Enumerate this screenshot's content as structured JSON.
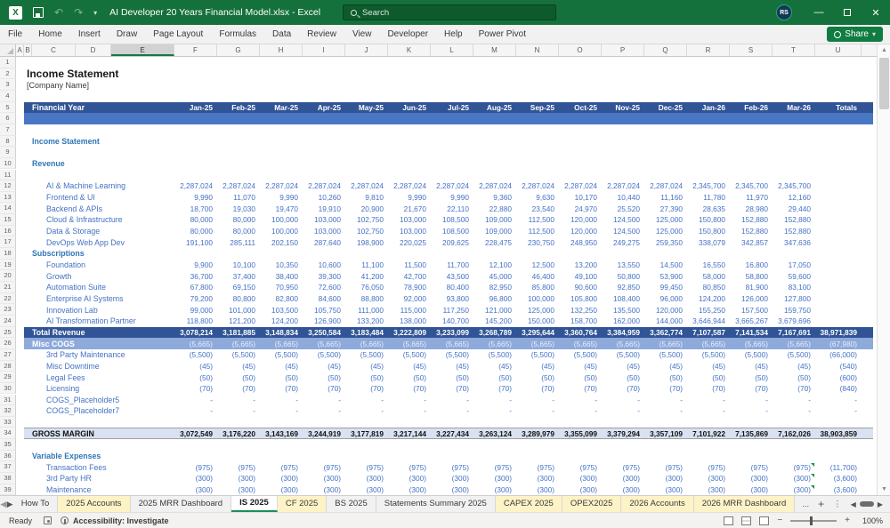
{
  "colors": {
    "excel_green": "#15713B",
    "accent_green": "#107C41",
    "band_dark_blue": "#305496",
    "band_mid_blue": "#4A77C4",
    "band_light_blue": "#8EAADB",
    "band_pale_blue": "#D9E2F2",
    "data_blue": "#4472C4",
    "section_blue": "#2E75B6",
    "tab_yellow": "#FDF3C7"
  },
  "titlebar": {
    "title": "AI Developer 20 Years Financial Model.xlsx  -  Excel",
    "search_placeholder": "Search",
    "avatar_initials": "RS"
  },
  "ribbon": {
    "tabs": [
      "File",
      "Home",
      "Insert",
      "Draw",
      "Page Layout",
      "Formulas",
      "Data",
      "Review",
      "View",
      "Developer",
      "Help",
      "Power Pivot"
    ],
    "share_label": "Share"
  },
  "columns": {
    "letters": [
      "A",
      "B",
      "C",
      "D",
      "E",
      "F",
      "G",
      "H",
      "I",
      "J",
      "K",
      "L",
      "M",
      "N",
      "O",
      "P",
      "Q",
      "R",
      "S",
      "T",
      "U"
    ],
    "widths": [
      9,
      9,
      49,
      40,
      71,
      48,
      48,
      48,
      48,
      48,
      48,
      48,
      48,
      48,
      48,
      48,
      48,
      48,
      48,
      48,
      52
    ],
    "selected": "E"
  },
  "sheet": {
    "months": [
      "Jan-25",
      "Feb-25",
      "Mar-25",
      "Apr-25",
      "May-25",
      "Jun-25",
      "Jul-25",
      "Aug-25",
      "Sep-25",
      "Oct-25",
      "Nov-25",
      "Dec-25",
      "Jan-26",
      "Feb-26",
      "Mar-26"
    ],
    "totals_label": "Totals",
    "rows": [
      {
        "n": 1,
        "type": "blank"
      },
      {
        "n": 2,
        "type": "title",
        "label": "Income Statement"
      },
      {
        "n": 3,
        "type": "subtitle",
        "label": "[Company Name]"
      },
      {
        "n": 4,
        "type": "blank"
      },
      {
        "n": 5,
        "type": "fy",
        "label": "Financial Year"
      },
      {
        "n": 6,
        "type": "band6"
      },
      {
        "n": 7,
        "type": "blank"
      },
      {
        "n": 8,
        "type": "section",
        "label": "Income Statement"
      },
      {
        "n": 9,
        "type": "blank"
      },
      {
        "n": 10,
        "type": "section",
        "label": "Revenue"
      },
      {
        "n": 11,
        "type": "blank"
      },
      {
        "n": 12,
        "type": "item",
        "label": "AI & Machine Learning",
        "values": [
          "2,287,024",
          "2,287,024",
          "2,287,024",
          "2,287,024",
          "2,287,024",
          "2,287,024",
          "2,287,024",
          "2,287,024",
          "2,287,024",
          "2,287,024",
          "2,287,024",
          "2,287,024",
          "2,345,700",
          "2,345,700",
          "2,345,700"
        ],
        "total": ""
      },
      {
        "n": 13,
        "type": "item",
        "label": "Frontend & UI",
        "values": [
          "9,990",
          "11,070",
          "9,990",
          "10,260",
          "9,810",
          "9,990",
          "9,990",
          "9,360",
          "9,630",
          "10,170",
          "10,440",
          "11,160",
          "11,780",
          "11,970",
          "12,160"
        ],
        "total": ""
      },
      {
        "n": 14,
        "type": "item",
        "label": "Backend & APIs",
        "values": [
          "18,700",
          "19,030",
          "19,470",
          "19,910",
          "20,900",
          "21,670",
          "22,110",
          "22,880",
          "23,540",
          "24,970",
          "25,520",
          "27,390",
          "28,635",
          "28,980",
          "29,440"
        ],
        "total": ""
      },
      {
        "n": 15,
        "type": "item",
        "label": "Cloud & Infrastructure",
        "values": [
          "80,000",
          "80,000",
          "100,000",
          "103,000",
          "102,750",
          "103,000",
          "108,500",
          "109,000",
          "112,500",
          "120,000",
          "124,500",
          "125,000",
          "150,800",
          "152,880",
          "152,880"
        ],
        "total": ""
      },
      {
        "n": 16,
        "type": "item",
        "label": "Data & Storage",
        "values": [
          "80,000",
          "80,000",
          "100,000",
          "103,000",
          "102,750",
          "103,000",
          "108,500",
          "109,000",
          "112,500",
          "120,000",
          "124,500",
          "125,000",
          "150,800",
          "152,880",
          "152,880"
        ],
        "total": ""
      },
      {
        "n": 17,
        "type": "item",
        "label": "DevOps Web App Dev",
        "values": [
          "191,100",
          "285,111",
          "202,150",
          "287,640",
          "198,900",
          "220,025",
          "209,625",
          "228,475",
          "230,750",
          "248,950",
          "249,275",
          "259,350",
          "338,079",
          "342,857",
          "347,636"
        ],
        "total": ""
      },
      {
        "n": 18,
        "type": "section",
        "label": "Subscriptions"
      },
      {
        "n": 19,
        "type": "item",
        "label": "Foundation",
        "values": [
          "9,900",
          "10,100",
          "10,350",
          "10,600",
          "11,100",
          "11,500",
          "11,700",
          "12,100",
          "12,500",
          "13,200",
          "13,550",
          "14,500",
          "16,550",
          "16,800",
          "17,050"
        ],
        "total": ""
      },
      {
        "n": 20,
        "type": "item",
        "label": "Growth",
        "values": [
          "36,700",
          "37,400",
          "38,400",
          "39,300",
          "41,200",
          "42,700",
          "43,500",
          "45,000",
          "46,400",
          "49,100",
          "50,800",
          "53,900",
          "58,000",
          "58,800",
          "59,600"
        ],
        "total": ""
      },
      {
        "n": 21,
        "type": "item",
        "label": "Automation Suite",
        "values": [
          "67,800",
          "69,150",
          "70,950",
          "72,600",
          "76,050",
          "78,900",
          "80,400",
          "82,950",
          "85,800",
          "90,600",
          "92,850",
          "99,450",
          "80,850",
          "81,900",
          "83,100"
        ],
        "total": ""
      },
      {
        "n": 22,
        "type": "item",
        "label": "Enterprise AI Systems",
        "values": [
          "79,200",
          "80,800",
          "82,800",
          "84,600",
          "88,800",
          "92,000",
          "93,800",
          "96,800",
          "100,000",
          "105,800",
          "108,400",
          "96,000",
          "124,200",
          "126,000",
          "127,800"
        ],
        "total": ""
      },
      {
        "n": 23,
        "type": "item",
        "label": "Innovation Lab",
        "values": [
          "99,000",
          "101,000",
          "103,500",
          "105,750",
          "111,000",
          "115,000",
          "117,250",
          "121,000",
          "125,000",
          "132,250",
          "135,500",
          "120,000",
          "155,250",
          "157,500",
          "159,750"
        ],
        "total": ""
      },
      {
        "n": 24,
        "type": "item",
        "label": "AI Transformation Partner",
        "values": [
          "118,800",
          "121,200",
          "124,200",
          "126,900",
          "133,200",
          "138,000",
          "140,700",
          "145,200",
          "150,000",
          "158,700",
          "162,000",
          "144,000",
          "3,646,944",
          "3,665,267",
          "3,679,696"
        ],
        "total": ""
      },
      {
        "n": 25,
        "type": "total",
        "label": "Total Revenue",
        "values": [
          "3,078,214",
          "3,181,885",
          "3,148,834",
          "3,250,584",
          "3,183,484",
          "3,222,809",
          "3,233,099",
          "3,268,789",
          "3,295,644",
          "3,360,764",
          "3,384,959",
          "3,362,774",
          "7,107,587",
          "7,141,534",
          "7,167,691"
        ],
        "total": "38,971,839"
      },
      {
        "n": 26,
        "type": "cogs",
        "label": "Misc COGS",
        "values": [
          "(5,665)",
          "(5,665)",
          "(5,665)",
          "(5,665)",
          "(5,665)",
          "(5,665)",
          "(5,665)",
          "(5,665)",
          "(5,665)",
          "(5,665)",
          "(5,665)",
          "(5,665)",
          "(5,665)",
          "(5,665)",
          "(5,665)"
        ],
        "total": "(67,980)"
      },
      {
        "n": 27,
        "type": "item",
        "label": "3rd Party Maintenance",
        "values": [
          "(5,500)",
          "(5,500)",
          "(5,500)",
          "(5,500)",
          "(5,500)",
          "(5,500)",
          "(5,500)",
          "(5,500)",
          "(5,500)",
          "(5,500)",
          "(5,500)",
          "(5,500)",
          "(5,500)",
          "(5,500)",
          "(5,500)"
        ],
        "total": "(66,000)"
      },
      {
        "n": 28,
        "type": "item",
        "label": "Misc Downtime",
        "values": [
          "(45)",
          "(45)",
          "(45)",
          "(45)",
          "(45)",
          "(45)",
          "(45)",
          "(45)",
          "(45)",
          "(45)",
          "(45)",
          "(45)",
          "(45)",
          "(45)",
          "(45)"
        ],
        "total": "(540)"
      },
      {
        "n": 29,
        "type": "item",
        "label": "Legal Fees",
        "values": [
          "(50)",
          "(50)",
          "(50)",
          "(50)",
          "(50)",
          "(50)",
          "(50)",
          "(50)",
          "(50)",
          "(50)",
          "(50)",
          "(50)",
          "(50)",
          "(50)",
          "(50)"
        ],
        "total": "(600)"
      },
      {
        "n": 30,
        "type": "item",
        "label": "Licensing",
        "values": [
          "(70)",
          "(70)",
          "(70)",
          "(70)",
          "(70)",
          "(70)",
          "(70)",
          "(70)",
          "(70)",
          "(70)",
          "(70)",
          "(70)",
          "(70)",
          "(70)",
          "(70)"
        ],
        "total": "(840)"
      },
      {
        "n": 31,
        "type": "item",
        "label": "COGS_Placeholder5",
        "values": [
          "-",
          "-",
          "-",
          "-",
          "-",
          "-",
          "-",
          "-",
          "-",
          "-",
          "-",
          "-",
          "-",
          "-",
          "-"
        ],
        "total": "-"
      },
      {
        "n": 32,
        "type": "item",
        "label": "COGS_Placeholder7",
        "values": [
          "-",
          "-",
          "-",
          "-",
          "-",
          "-",
          "-",
          "-",
          "-",
          "-",
          "-",
          "-",
          "-",
          "-",
          "-"
        ],
        "total": "-"
      },
      {
        "n": 33,
        "type": "blank"
      },
      {
        "n": 34,
        "type": "gross",
        "label": "GROSS MARGIN",
        "values": [
          "3,072,549",
          "3,176,220",
          "3,143,169",
          "3,244,919",
          "3,177,819",
          "3,217,144",
          "3,227,434",
          "3,263,124",
          "3,289,979",
          "3,355,099",
          "3,379,294",
          "3,357,109",
          "7,101,922",
          "7,135,869",
          "7,162,026"
        ],
        "total": "38,903,859"
      },
      {
        "n": 35,
        "type": "blank"
      },
      {
        "n": 36,
        "type": "section",
        "label": "Variable Expenses"
      },
      {
        "n": 37,
        "type": "item",
        "label": "Transaction Fees",
        "values": [
          "(975)",
          "(975)",
          "(975)",
          "(975)",
          "(975)",
          "(975)",
          "(975)",
          "(975)",
          "(975)",
          "(975)",
          "(975)",
          "(975)",
          "(975)",
          "(975)",
          "(975)"
        ],
        "total": "(11,700)",
        "flag": true
      },
      {
        "n": 38,
        "type": "item",
        "label": "3rd Party HR",
        "values": [
          "(300)",
          "(300)",
          "(300)",
          "(300)",
          "(300)",
          "(300)",
          "(300)",
          "(300)",
          "(300)",
          "(300)",
          "(300)",
          "(300)",
          "(300)",
          "(300)",
          "(300)"
        ],
        "total": "(3,600)",
        "flag": true
      },
      {
        "n": 39,
        "type": "item",
        "label": "Maintenance",
        "values": [
          "(300)",
          "(300)",
          "(300)",
          "(300)",
          "(300)",
          "(300)",
          "(300)",
          "(300)",
          "(300)",
          "(300)",
          "(300)",
          "(300)",
          "(300)",
          "(300)",
          "(300)"
        ],
        "total": "(3,600)",
        "flag": true
      },
      {
        "n": 40,
        "type": "blank"
      }
    ]
  },
  "tabs": {
    "items": [
      {
        "label": "How To",
        "style": "plain"
      },
      {
        "label": "2025 Accounts",
        "style": "yellow"
      },
      {
        "label": "2025 MRR Dashboard",
        "style": "plain"
      },
      {
        "label": "IS 2025",
        "style": "active"
      },
      {
        "label": "CF 2025",
        "style": "yellow"
      },
      {
        "label": "BS 2025",
        "style": "plain"
      },
      {
        "label": "Statements Summary 2025",
        "style": "plain"
      },
      {
        "label": "CAPEX 2025",
        "style": "yellow"
      },
      {
        "label": "OPEX2025",
        "style": "yellow"
      },
      {
        "label": "2026 Accounts",
        "style": "yellow"
      },
      {
        "label": "2026 MRR Dashboard",
        "style": "yellow"
      }
    ],
    "more": "...",
    "add": "+"
  },
  "statusbar": {
    "ready": "Ready",
    "accessibility": "Accessibility: Investigate",
    "zoom": "100%"
  }
}
